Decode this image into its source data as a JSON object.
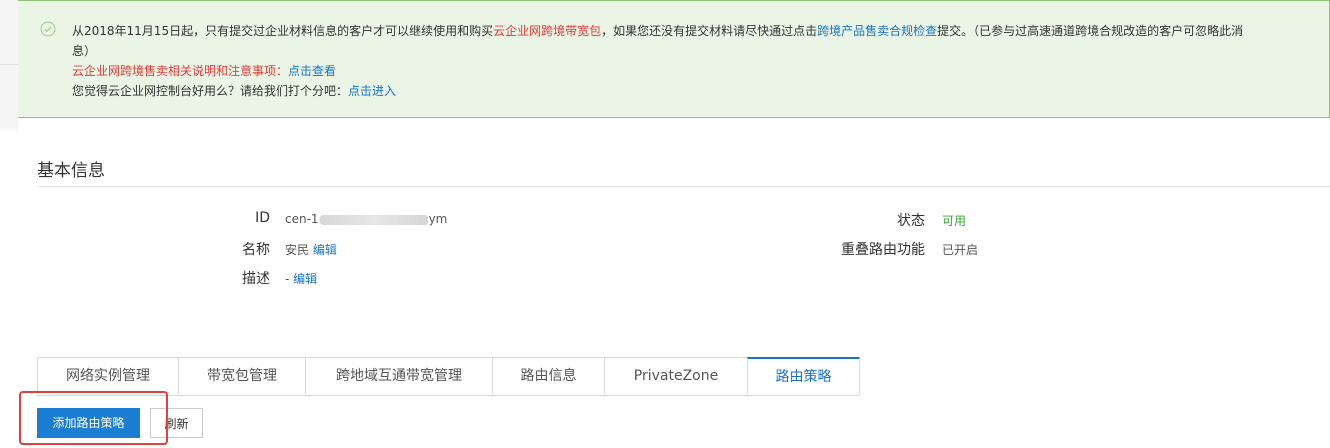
{
  "notice": {
    "line1": [
      {
        "text": "从2018年11月15日起，只有提交过企业材料信息的客户才可以继续使用和购买",
        "style": "plain"
      },
      {
        "text": "云企业网跨境带宽包",
        "style": "red"
      },
      {
        "text": "，如果您还没有提交材料请尽快通过点击",
        "style": "plain"
      },
      {
        "text": "跨境产品售卖合规检查",
        "style": "link"
      },
      {
        "text": "提交。（已参与过高速通道跨境合规改造的客户可忽略此消",
        "style": "plain"
      }
    ],
    "line1_wrap": "息）",
    "line2_label": "云企业网跨境售卖相关说明和注意事项：",
    "line2_link": "点击查看",
    "line3_label": "您觉得云企业网控制台好用么？请给我们打个分吧：",
    "line3_link": "点击进入"
  },
  "basic_info": {
    "title": "基本信息",
    "id_label": "ID",
    "id_prefix": "cen-1",
    "id_suffix": "ym",
    "name_label": "名称",
    "name_value": "安民",
    "edit_label": "编辑",
    "desc_label": "描述",
    "desc_value": "-",
    "status_label": "状态",
    "status_value": "可用",
    "overlap_label": "重叠路由功能",
    "overlap_value": "已开启"
  },
  "tabs": [
    {
      "label": "网络实例管理",
      "active": false
    },
    {
      "label": "带宽包管理",
      "active": false
    },
    {
      "label": "跨地域互通带宽管理",
      "active": false
    },
    {
      "label": "路由信息",
      "active": false
    },
    {
      "label": "PrivateZone",
      "active": false
    },
    {
      "label": "路由策略",
      "active": true
    }
  ],
  "actions": {
    "add_label": "添加路由策略",
    "refresh_label": "刷新"
  },
  "colors": {
    "accent": "#1a73c8",
    "primary_button": "#1b7ed3",
    "notice_bg": "#eaf5e6",
    "notice_border": "#8cc474",
    "warning_red": "#e23c39",
    "status_green": "#3aa53a",
    "highlight_box": "#e0403f"
  },
  "icons": {
    "notice": "check-circle-icon"
  }
}
